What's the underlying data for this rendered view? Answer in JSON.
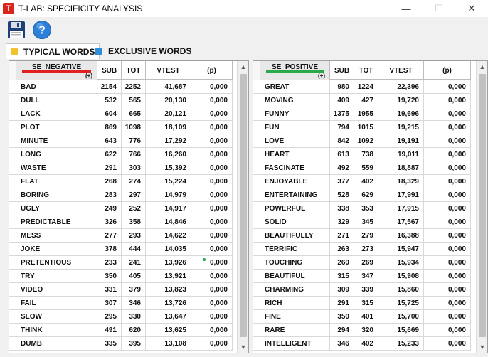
{
  "window": {
    "title": "T-LAB: SPECIFICITY ANALYSIS",
    "icon_letter": "T"
  },
  "toolbar": {
    "save_icon": "floppy-disk-icon",
    "help_icon": "help-icon"
  },
  "tabs": [
    {
      "label": "TYPICAL WORDS",
      "color": "#f2c12e",
      "active": true
    },
    {
      "label": "EXCLUSIVE WORDS",
      "color": "#2f8fd8",
      "active": false
    }
  ],
  "left_table": {
    "group": "SE_NEGATIVE",
    "group_color": "#e02020",
    "plus": "(+)",
    "columns": [
      "SUB",
      "TOT",
      "VTEST",
      "(p)"
    ],
    "rows": [
      [
        "BAD",
        "2154",
        "2252",
        "41,687",
        "0,000"
      ],
      [
        "DULL",
        "532",
        "565",
        "20,130",
        "0,000"
      ],
      [
        "LACK",
        "604",
        "665",
        "20,121",
        "0,000"
      ],
      [
        "PLOT",
        "869",
        "1098",
        "18,109",
        "0,000"
      ],
      [
        "MINUTE",
        "643",
        "776",
        "17,292",
        "0,000"
      ],
      [
        "LONG",
        "622",
        "766",
        "16,260",
        "0,000"
      ],
      [
        "WASTE",
        "291",
        "303",
        "15,392",
        "0,000"
      ],
      [
        "FLAT",
        "268",
        "274",
        "15,224",
        "0,000"
      ],
      [
        "BORING",
        "283",
        "297",
        "14,979",
        "0,000"
      ],
      [
        "UGLY",
        "249",
        "252",
        "14,917",
        "0,000"
      ],
      [
        "PREDICTABLE",
        "326",
        "358",
        "14,846",
        "0,000"
      ],
      [
        "MESS",
        "277",
        "293",
        "14,622",
        "0,000"
      ],
      [
        "JOKE",
        "378",
        "444",
        "14,035",
        "0,000"
      ],
      [
        "PRETENTIOUS",
        "233",
        "241",
        "13,926",
        "0,000"
      ],
      [
        "TRY",
        "350",
        "405",
        "13,921",
        "0,000"
      ],
      [
        "VIDEO",
        "331",
        "379",
        "13,823",
        "0,000"
      ],
      [
        "FAIL",
        "307",
        "346",
        "13,726",
        "0,000"
      ],
      [
        "SLOW",
        "295",
        "330",
        "13,647",
        "0,000"
      ],
      [
        "THINK",
        "491",
        "620",
        "13,625",
        "0,000"
      ],
      [
        "DUMB",
        "335",
        "395",
        "13,108",
        "0,000"
      ]
    ]
  },
  "right_table": {
    "group": "SE_POSITIVE",
    "group_color": "#2aa84a",
    "plus": "(+)",
    "columns": [
      "SUB",
      "TOT",
      "VTEST",
      "(p)"
    ],
    "rows": [
      [
        "GREAT",
        "980",
        "1224",
        "22,396",
        "0,000"
      ],
      [
        "MOVING",
        "409",
        "427",
        "19,720",
        "0,000"
      ],
      [
        "FUNNY",
        "1375",
        "1955",
        "19,696",
        "0,000"
      ],
      [
        "FUN",
        "794",
        "1015",
        "19,215",
        "0,000"
      ],
      [
        "LOVE",
        "842",
        "1092",
        "19,191",
        "0,000"
      ],
      [
        "HEART",
        "613",
        "738",
        "19,011",
        "0,000"
      ],
      [
        "FASCINATE",
        "492",
        "559",
        "18,887",
        "0,000"
      ],
      [
        "ENJOYABLE",
        "377",
        "402",
        "18,329",
        "0,000"
      ],
      [
        "ENTERTAINING",
        "528",
        "629",
        "17,991",
        "0,000"
      ],
      [
        "POWERFUL",
        "338",
        "353",
        "17,915",
        "0,000"
      ],
      [
        "SOLID",
        "329",
        "345",
        "17,567",
        "0,000"
      ],
      [
        "BEAUTIFULLY",
        "271",
        "279",
        "16,388",
        "0,000"
      ],
      [
        "TERRIFIC",
        "263",
        "273",
        "15,947",
        "0,000"
      ],
      [
        "TOUCHING",
        "260",
        "269",
        "15,934",
        "0,000"
      ],
      [
        "BEAUTIFUL",
        "315",
        "347",
        "15,908",
        "0,000"
      ],
      [
        "CHARMING",
        "309",
        "339",
        "15,860",
        "0,000"
      ],
      [
        "RICH",
        "291",
        "315",
        "15,725",
        "0,000"
      ],
      [
        "FINE",
        "350",
        "401",
        "15,700",
        "0,000"
      ],
      [
        "RARE",
        "294",
        "320",
        "15,669",
        "0,000"
      ],
      [
        "INTELLIGENT",
        "346",
        "402",
        "15,233",
        "0,000"
      ]
    ]
  }
}
